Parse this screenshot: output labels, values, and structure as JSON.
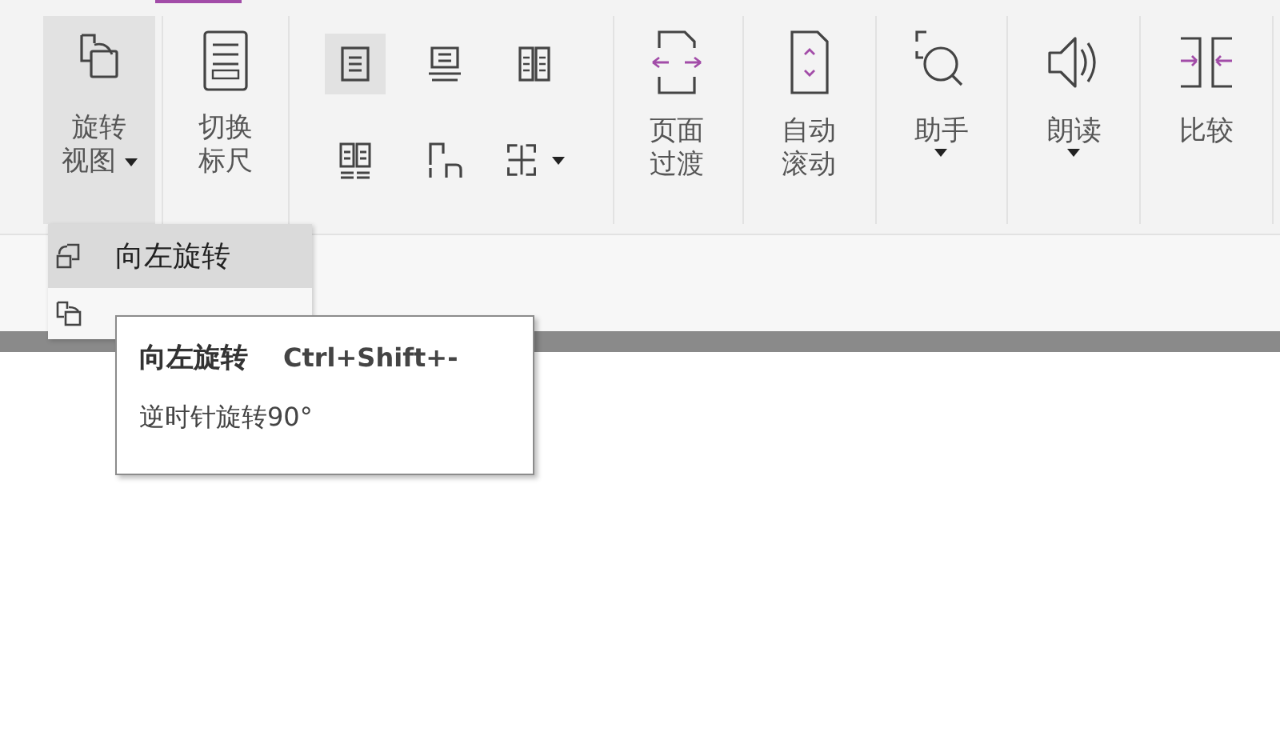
{
  "ribbon": {
    "large_buttons": [
      {
        "kind": "rotate",
        "lines": [
          "旋转",
          "视图"
        ],
        "dropdown": true,
        "selected": true
      },
      {
        "kind": "ruler",
        "lines": [
          "切换",
          "标尺"
        ],
        "dropdown": false,
        "selected": false
      }
    ],
    "layout_buttons": [
      {
        "kind": "single",
        "selected": true
      },
      {
        "kind": "continuous",
        "selected": false
      },
      {
        "kind": "facing",
        "selected": false
      },
      {
        "kind": "cont-facing",
        "selected": false
      },
      {
        "kind": "cover",
        "selected": false
      },
      {
        "kind": "split",
        "selected": false,
        "dropdown": true
      }
    ],
    "tool_buttons": [
      {
        "kind": "transition",
        "lines": [
          "页面",
          "过渡"
        ],
        "dropdown": false
      },
      {
        "kind": "scroll",
        "lines": [
          "自动",
          "滚动"
        ],
        "dropdown": false
      },
      {
        "kind": "assistant",
        "lines": [
          "助手"
        ],
        "dropdown": true
      },
      {
        "kind": "read",
        "lines": [
          "朗读"
        ],
        "dropdown": true
      },
      {
        "kind": "compare",
        "lines": [
          "比较"
        ],
        "dropdown": false
      }
    ]
  },
  "menu": {
    "items": [
      {
        "kind": "left",
        "label": "向左旋转",
        "selected": true
      },
      {
        "kind": "right",
        "selected": false
      }
    ]
  },
  "tooltip": {
    "title": "向左旋转",
    "shortcut": "Ctrl+Shift+-",
    "description": "逆时针旋转90°"
  }
}
